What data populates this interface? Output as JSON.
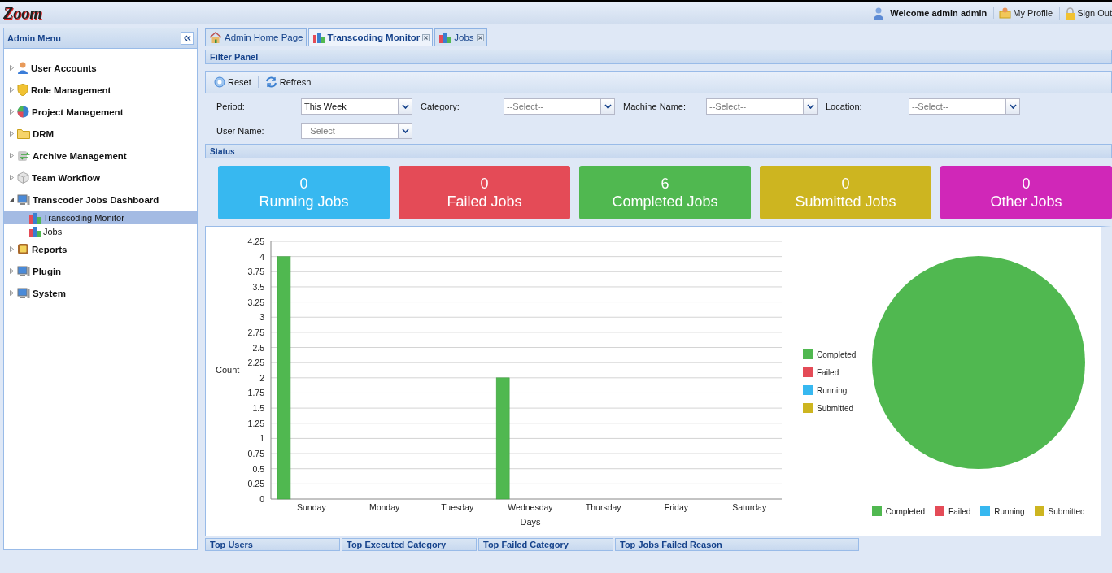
{
  "header": {
    "logo": "Zoom",
    "welcome": "Welcome admin admin",
    "links": [
      "My Profile",
      "Sign Out"
    ]
  },
  "sidebar": {
    "title": "Admin Menu",
    "items": [
      {
        "label": "User Accounts",
        "expanded": false
      },
      {
        "label": "Role Management",
        "expanded": false
      },
      {
        "label": "Project Management",
        "expanded": false
      },
      {
        "label": "DRM",
        "expanded": false
      },
      {
        "label": "Archive Management",
        "expanded": false
      },
      {
        "label": "Team Workflow",
        "expanded": false
      },
      {
        "label": "Transcoder Jobs Dashboard",
        "expanded": true,
        "children": [
          {
            "label": "Transcoding Monitor",
            "selected": true
          },
          {
            "label": "Jobs",
            "selected": false
          }
        ]
      },
      {
        "label": "Reports",
        "expanded": false
      },
      {
        "label": "Plugin",
        "expanded": false
      },
      {
        "label": "System",
        "expanded": false
      }
    ]
  },
  "tabs": [
    {
      "label": "Admin Home Page",
      "selected": false,
      "closable": false
    },
    {
      "label": "Transcoding Monitor",
      "selected": true,
      "closable": true
    },
    {
      "label": "Jobs",
      "selected": false,
      "closable": true
    }
  ],
  "filter_panel": {
    "title": "Filter Panel",
    "toolbar": [
      "Reset",
      "Refresh"
    ],
    "filters": [
      {
        "label": "Period:",
        "value": "This Week"
      },
      {
        "label": "Category:",
        "placeholder": "--Select--"
      },
      {
        "label": "Machine Name:",
        "placeholder": "--Select--"
      },
      {
        "label": "Location:",
        "placeholder": "--Select--"
      },
      {
        "label": "User Name:",
        "placeholder": "--Select--"
      }
    ]
  },
  "status": {
    "title": "Status",
    "cards": [
      {
        "count": "0",
        "label": "Running Jobs",
        "color": "#37b8f0"
      },
      {
        "count": "0",
        "label": "Failed Jobs",
        "color": "#e44b57"
      },
      {
        "count": "6",
        "label": "Completed Jobs",
        "color": "#50b850"
      },
      {
        "count": "0",
        "label": "Submitted Jobs",
        "color": "#cdb520"
      },
      {
        "count": "0",
        "label": "Other Jobs",
        "color": "#d027b8"
      }
    ]
  },
  "bar_chart": {
    "chart_data": {
      "type": "bar",
      "xlabel": "Days",
      "ylabel": "Count",
      "categories": [
        "Sunday",
        "Monday",
        "Tuesday",
        "Wednesday",
        "Thursday",
        "Friday",
        "Saturday"
      ],
      "series": [
        {
          "name": "Completed",
          "color": "#50b850",
          "values": [
            4,
            0,
            0,
            2,
            0,
            0,
            0
          ]
        },
        {
          "name": "Failed",
          "color": "#e44b57",
          "values": [
            0,
            0,
            0,
            0,
            0,
            0,
            0
          ]
        },
        {
          "name": "Running",
          "color": "#37b8f0",
          "values": [
            0,
            0,
            0,
            0,
            0,
            0,
            0
          ]
        },
        {
          "name": "Submitted",
          "color": "#cdb520",
          "values": [
            0,
            0,
            0,
            0,
            0,
            0,
            0
          ]
        }
      ],
      "grid": true,
      "ylim": [
        0,
        4.25
      ],
      "yticks": [
        0,
        0.25,
        0.5,
        0.75,
        1,
        1.25,
        1.5,
        1.75,
        2,
        2.25,
        2.5,
        2.75,
        3,
        3.25,
        3.5,
        3.75,
        4,
        4.25
      ]
    }
  },
  "pie_chart": {
    "chart_data": {
      "type": "pie",
      "categories": [
        "Completed",
        "Failed",
        "Running",
        "Submitted"
      ],
      "values": [
        100,
        0,
        0,
        0
      ],
      "colors": [
        "#50b850",
        "#e44b57",
        "#37b8f0",
        "#cdb520"
      ]
    }
  },
  "bottom_panels": [
    "Top Users",
    "Top Executed Category",
    "Top Failed Category",
    "Top Jobs Failed Reason"
  ]
}
